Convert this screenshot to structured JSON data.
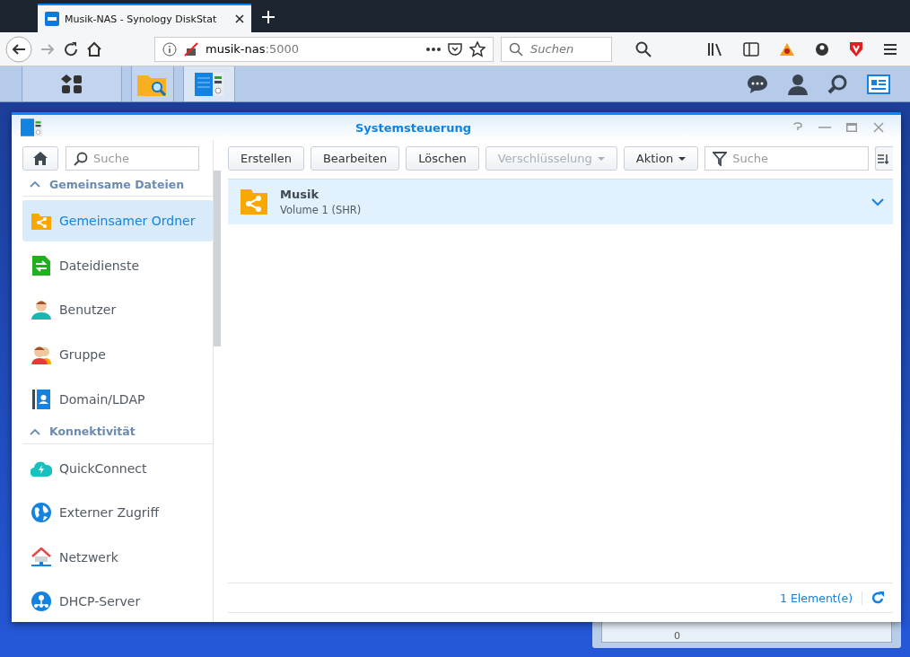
{
  "browser": {
    "tab_title": "Musik-NAS - Synology DiskStat",
    "url_host": "musik-nas",
    "url_port": ":5000",
    "search": {
      "placeholder": "Suchen"
    }
  },
  "taskbar": {
    "apps": [
      {
        "selected": false
      },
      {
        "selected": false
      },
      {
        "selected": true
      }
    ]
  },
  "window": {
    "title": "Systemsteuerung"
  },
  "sidebar": {
    "search": {
      "placeholder": "Suche"
    },
    "sections": [
      {
        "title": "Gemeinsame Dateien",
        "expanded": true,
        "items": [
          {
            "label": "Gemeinsamer Ordner",
            "selected": true
          },
          {
            "label": "Dateidienste",
            "selected": false
          },
          {
            "label": "Benutzer",
            "selected": false
          },
          {
            "label": "Gruppe",
            "selected": false
          },
          {
            "label": "Domain/LDAP",
            "selected": false
          }
        ]
      },
      {
        "title": "Konnektivität",
        "expanded": true,
        "items": [
          {
            "label": "QuickConnect",
            "selected": false
          },
          {
            "label": "Externer Zugriff",
            "selected": false
          },
          {
            "label": "Netzwerk",
            "selected": false
          },
          {
            "label": "DHCP-Server",
            "selected": false
          }
        ]
      }
    ]
  },
  "toolbar": {
    "buttons": [
      {
        "label": "Erstellen",
        "disabled": false,
        "dropdown": false
      },
      {
        "label": "Bearbeiten",
        "disabled": false,
        "dropdown": false
      },
      {
        "label": "Löschen",
        "disabled": false,
        "dropdown": false
      },
      {
        "label": "Verschlüsselung",
        "disabled": true,
        "dropdown": true
      },
      {
        "label": "Aktion",
        "disabled": false,
        "dropdown": true
      }
    ],
    "search": {
      "placeholder": "Suche"
    }
  },
  "list": {
    "rows": [
      {
        "name": "Musik",
        "detail": "Volume 1 (SHR)",
        "selected": true
      }
    ]
  },
  "footer": {
    "count": "1 Element(e)"
  },
  "background_widget": {
    "axis_label": "0"
  }
}
